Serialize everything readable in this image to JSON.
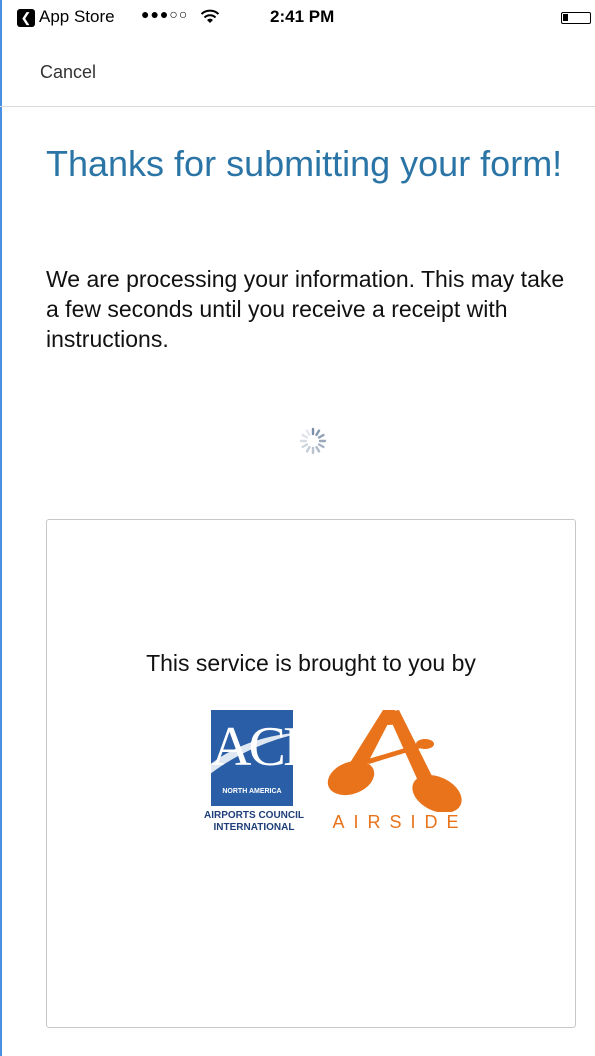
{
  "status_bar": {
    "back_app": "App Store",
    "signal": "●●●○○",
    "time": "2:41 PM",
    "battery_level": 0.2
  },
  "nav": {
    "cancel_label": "Cancel"
  },
  "main": {
    "title": "Thanks for submitting your form!",
    "message": "We are processing your information. This may take a few seconds until you receive a receipt with instructions."
  },
  "sponsor": {
    "intro": "This service is brought to you by",
    "aci": {
      "letters": "ACI",
      "region": "NORTH AMERICA",
      "name_line1": "AIRPORTS COUNCIL",
      "name_line2": "INTERNATIONAL"
    },
    "airside": {
      "wordmark": "AIRSIDE"
    }
  },
  "colors": {
    "title": "#2a74a6",
    "aci_blue": "#2a5fa8",
    "airside_orange": "#e8731a",
    "frame_accent": "#4a90e2"
  },
  "icons": [
    "back-badge-icon",
    "wifi-icon",
    "battery-icon",
    "loading-spinner-icon"
  ]
}
